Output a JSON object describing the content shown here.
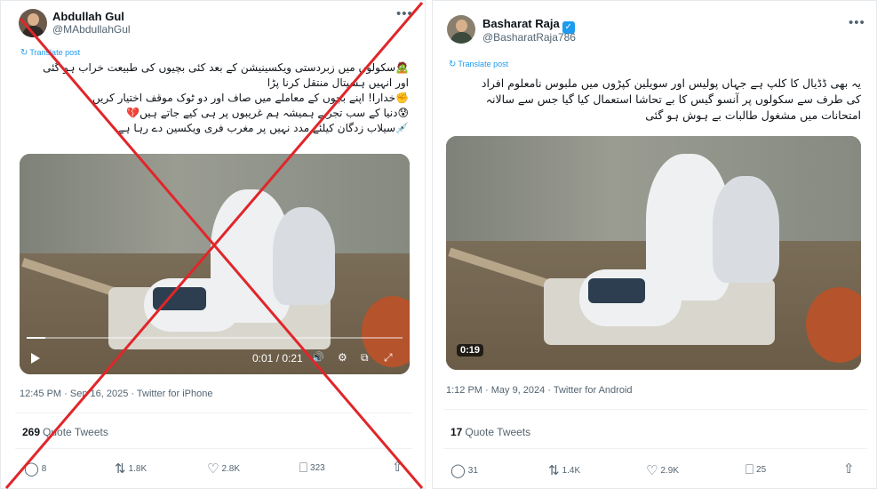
{
  "left_tweet": {
    "author_name": "Abdullah Gul",
    "author_handle": "@MAbdullahGul",
    "more_icon": "•••",
    "translate_label": "Translate post",
    "text_lines": [
      "🧟سکولوں میں زبردستی ویکسینیشن کے بعد کئی بچیوں کی طبیعت خراب ہو گئی",
      "اور انہیں ہسپتال منتقل کرنا پڑا",
      "✊خدارا! اپنے بچوں کے معاملے میں صاف اور دو ٹوک موقف اختیار کریں",
      "😰دنیا کے سب تجربے ہمیشہ ہم غریبوں پر ہی کیے جاتے ہیں💔",
      "💉سیلاب زدگان کیلئے مدد نہیں پر مغرب فری ویکسین دے رہا ہے"
    ],
    "video": {
      "time_display": "0:01 / 0:21",
      "progress": 0.05
    },
    "timestamp": "12:45 PM · Sep 16, 2025 · Twitter for iPhone",
    "quote_count": "269",
    "quote_label": "Quote Tweets",
    "actions": {
      "replies": "8",
      "retweets": "1.8K",
      "likes": "2.8K",
      "bookmarks": "323"
    },
    "overlay_color": "#e0262a"
  },
  "right_tweet": {
    "author_name": "Basharat Raja",
    "author_handle": "@BasharatRaja786",
    "more_icon": "•••",
    "translate_label": "Translate post",
    "text_lines": [
      "یہ بھی ڈڈیال کا کلپ ہے جہاں پولیس اور سویلین کپڑوں میں ملبوس نامعلوم افراد",
      "کی طرف سے سکولوں پر آنسو گیس کا بے تحاشا استعمال کیا گیا جس سے سالانہ",
      "امتحانات میں مشغول طالبات بے ہوش ہو گئی"
    ],
    "video": {
      "duration_badge": "0:19"
    },
    "timestamp": "1:12 PM · May 9, 2024 · Twitter for Android",
    "quote_count": "17",
    "quote_label": "Quote Tweets",
    "actions": {
      "replies": "31",
      "retweets": "1.4K",
      "likes": "2.9K",
      "bookmarks": "25"
    }
  },
  "icons": {
    "translate": "↻",
    "reply": "◯",
    "retweet": "⇅",
    "like": "♡",
    "bookmark": "⎕",
    "share": "⇧",
    "volume": "🔊",
    "settings": "⚙",
    "pip": "⧉",
    "fullscreen": "⤢"
  },
  "colors": {
    "link_blue": "#1d9bf0",
    "secondary_text": "#536471",
    "primary_text": "#0f1419",
    "cross_red": "#e0262a"
  }
}
